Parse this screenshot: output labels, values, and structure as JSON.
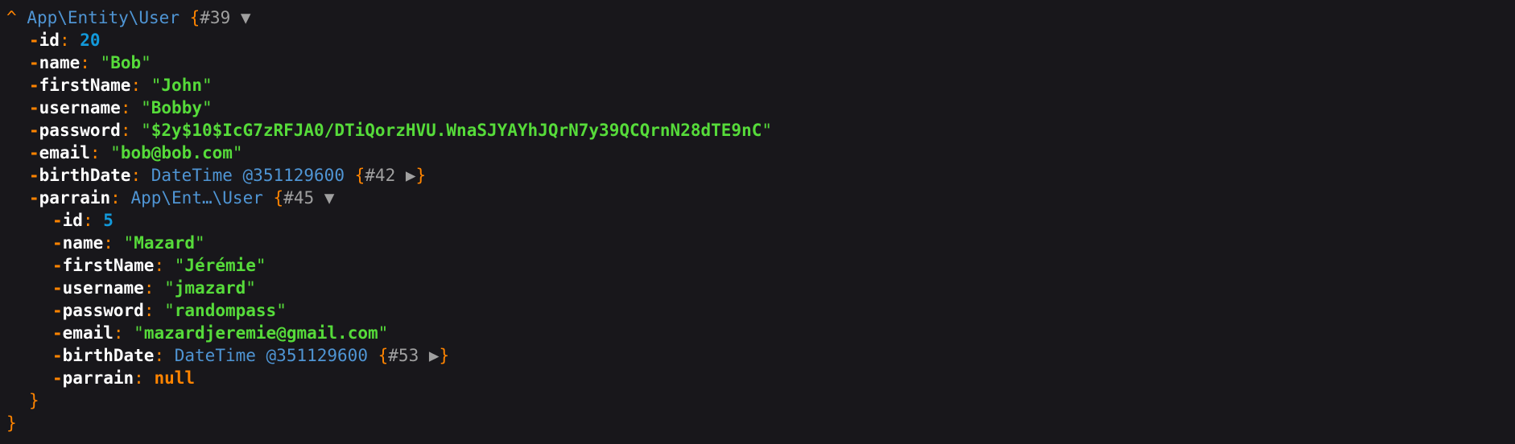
{
  "colors": {
    "background": "#18171b",
    "key": "#ffffff",
    "punctuation": "#ff8400",
    "string": "#56db3a",
    "number": "#1299da",
    "class": "#4f95d4",
    "ref": "#a0a0a0"
  },
  "root": {
    "collapse_glyph": "^",
    "class": "App\\Entity\\User",
    "ref": "#39",
    "toggle_glyph": "▼",
    "fields": {
      "id": {
        "key": "id",
        "value": "20"
      },
      "name": {
        "key": "name",
        "value": "Bob"
      },
      "firstName": {
        "key": "firstName",
        "value": "John"
      },
      "username": {
        "key": "username",
        "value": "Bobby"
      },
      "password": {
        "key": "password",
        "value": "$2y$10$IcG7zRFJA0/DTiQorzHVU.WnaSJYAYhJQrN7y39QCQrnN28dTE9nC"
      },
      "email": {
        "key": "email",
        "value": "bob@bob.com"
      },
      "birthDate": {
        "key": "birthDate",
        "class": "DateTime @351129600",
        "ref": "#42",
        "toggle_glyph": "▶"
      },
      "parrain": {
        "key": "parrain",
        "class_start": "App\\Ent",
        "class_ellipsis": "…",
        "class_end": "\\User",
        "ref": "#45",
        "toggle_glyph": "▼",
        "fields": {
          "id": {
            "key": "id",
            "value": "5"
          },
          "name": {
            "key": "name",
            "value": "Mazard"
          },
          "firstName": {
            "key": "firstName",
            "value": "Jérémie"
          },
          "username": {
            "key": "username",
            "value": "jmazard"
          },
          "password": {
            "key": "password",
            "value": "randompass"
          },
          "email": {
            "key": "email",
            "value": "mazardjeremie@gmail.com"
          },
          "birthDate": {
            "key": "birthDate",
            "class": "DateTime @351129600",
            "ref": "#53",
            "toggle_glyph": "▶"
          },
          "parrain": {
            "key": "parrain",
            "value": "null"
          }
        }
      }
    }
  }
}
